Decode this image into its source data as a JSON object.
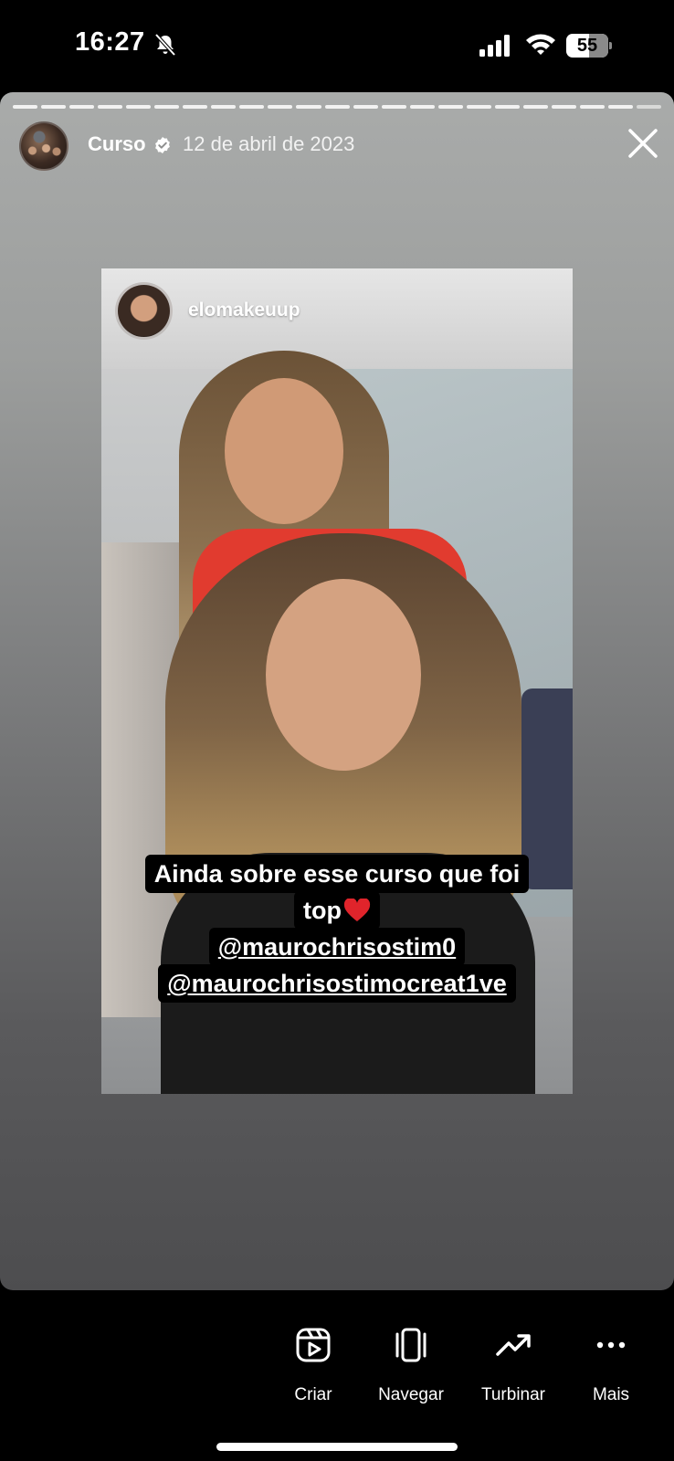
{
  "status_bar": {
    "time": "16:27",
    "battery_level": "55",
    "battery_fraction": 0.55
  },
  "story": {
    "progress_segments": 23,
    "active_segments": 22,
    "username": "Curso",
    "verified": true,
    "date": "12 de abril de 2023"
  },
  "post": {
    "username": "elomakeuup",
    "caption_line1": "Ainda sobre esse curso que foi",
    "caption_line2": "top",
    "mention1": "@maurochrisostim0",
    "mention2": "@maurochrisostimocreat1ve"
  },
  "toolbar": {
    "items": [
      {
        "label": "Criar",
        "icon": "reels-create-icon"
      },
      {
        "label": "Navegar",
        "icon": "browse-icon"
      },
      {
        "label": "Turbinar",
        "icon": "trending-up-icon"
      },
      {
        "label": "Mais",
        "icon": "more-dots-icon"
      }
    ]
  },
  "colors": {
    "background": "#000000",
    "heart": "#e0242b",
    "verified": "#ffffff"
  }
}
